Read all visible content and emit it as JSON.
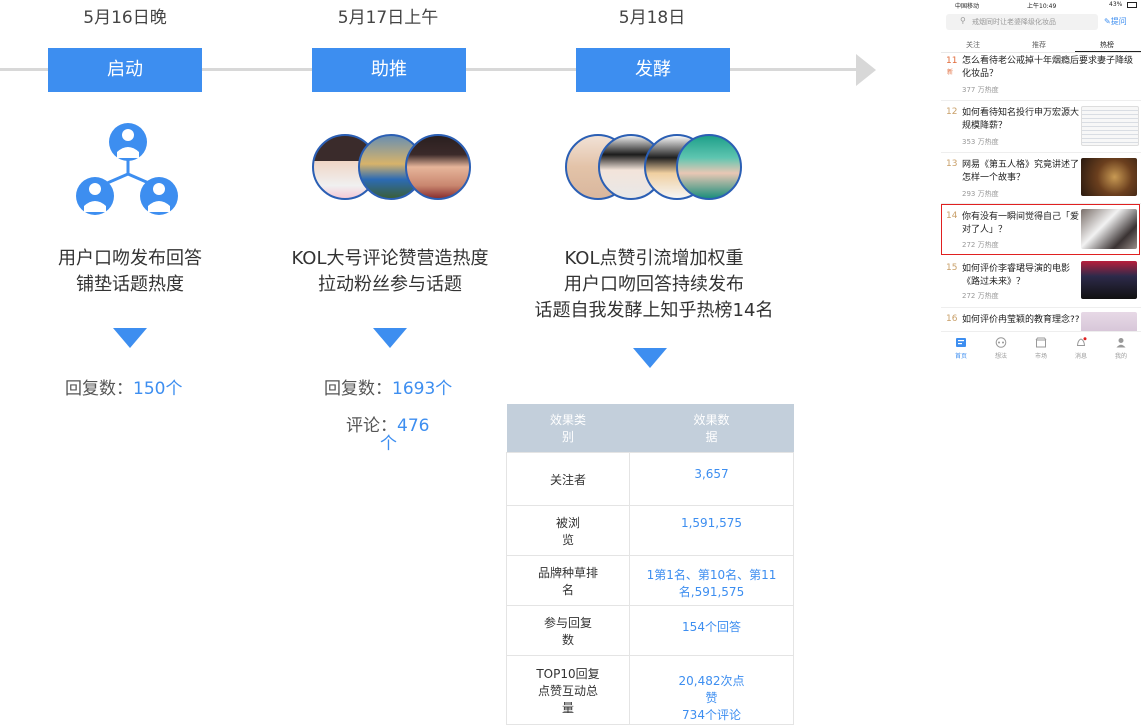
{
  "timeline": {
    "stages": [
      {
        "date": "5月16日晚",
        "label": "启动",
        "desc": [
          "用户口吻发布回答",
          "铺垫话题热度"
        ],
        "stat_label": "回复数：",
        "stat_value": "150个"
      },
      {
        "date": "5月17日上午",
        "label": "助推",
        "desc": [
          "KOL大号评论赞营造热度",
          "拉动粉丝参与话题"
        ],
        "stat_label": "回复数：",
        "stat_value": "1693个",
        "stat2_label": "评论：",
        "stat2_value_a": "476",
        "stat2_value_b": "个"
      },
      {
        "date": "5月18日",
        "label": "发酵",
        "desc": [
          "KOL点赞引流增加权重",
          "用户口吻回答持续发布",
          "话题自我发酵上知乎热榜14名"
        ]
      }
    ],
    "colors": {
      "accent": "#3d8ef0",
      "table_header": "#c3cfdb"
    }
  },
  "results_table": {
    "headers": [
      "效果类别",
      "效果数据"
    ],
    "rows": [
      {
        "category": "关注者",
        "value": "3,657"
      },
      {
        "category": "被浏览",
        "value": "1,591,575"
      },
      {
        "category": "品牌种草排名",
        "value": "1第1名、第10名、第11名,591,575"
      },
      {
        "category": "参与回复数",
        "value": "154个回答"
      },
      {
        "category": "TOP10回复点赞互动总量",
        "value_a": "20,482次点赞",
        "value_b": "734个评论"
      }
    ]
  },
  "phone": {
    "status": {
      "carrier": "中国移动",
      "time": "上午10:49",
      "battery": "43%"
    },
    "search_placeholder": "戒烟同时让老婆降级化妆品",
    "ask_label": "提问",
    "tabs": [
      "关注",
      "推荐",
      "热榜"
    ],
    "items": [
      {
        "rank": "11",
        "title": "怎么看待老公戒掉十年烟瘾后要求妻子降级化妆品？",
        "heat": "377 万热度"
      },
      {
        "rank": "12",
        "title": "如何看待知名投行申万宏源大规模降薪？",
        "heat": "353 万热度"
      },
      {
        "rank": "13",
        "title": "网易《第五人格》究竟讲述了怎样一个故事？",
        "heat": "293 万热度"
      },
      {
        "rank": "14",
        "title": "你有没有一瞬间觉得自己「爱对了人」？",
        "heat": "272 万热度"
      },
      {
        "rank": "15",
        "title": "如何评价李睿珺导演的电影《路过未来》？",
        "heat": "272 万热度"
      },
      {
        "rank": "16",
        "title": "如何评价冉莹颖的教育理念??",
        "heat": ""
      }
    ],
    "nav": [
      "首页",
      "想法",
      "市场",
      "消息",
      "我的"
    ]
  }
}
